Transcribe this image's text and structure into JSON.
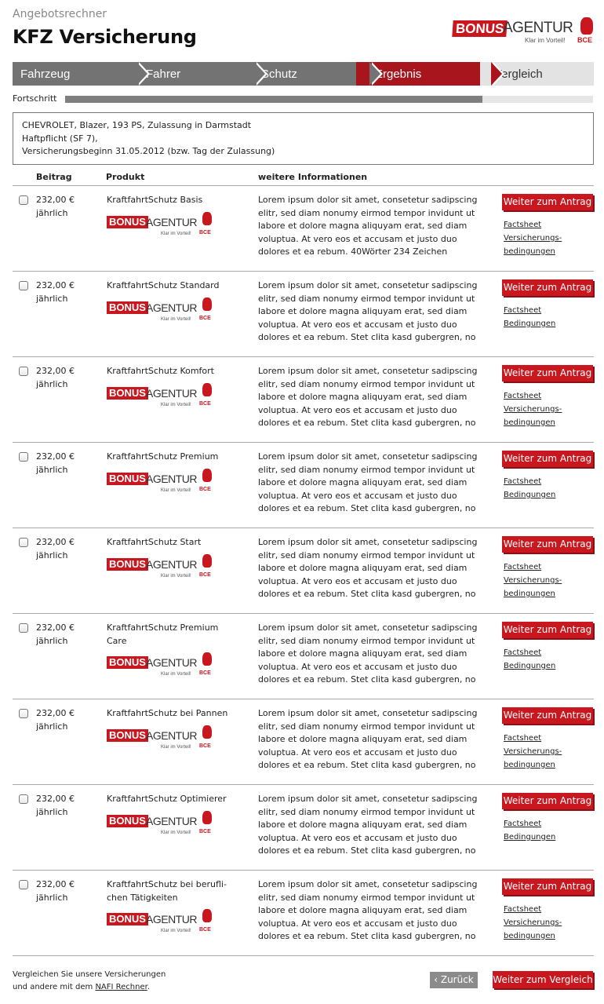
{
  "header": {
    "subtitle": "Angebotsrechner",
    "title": "KFZ Versicherung"
  },
  "logo": {
    "bonus": "BONUS",
    "agentur": "AGENTUR",
    "tagline": "Klar im Vorteil!",
    "bce": "BCE"
  },
  "steps": [
    "Fahrzeug",
    "Fahrer",
    "Schutz",
    "Ergebnis",
    "Vergleich"
  ],
  "progress": {
    "label": "Fortschritt",
    "fraction": 0.79
  },
  "summary": {
    "line1": "CHEVROLET, Blazer, 193 PS, Zulassung in Darmstadt",
    "line2": "Haftpflicht (SF 7),",
    "line3": "Versicherungsbeginn 31.05.2012 (bzw. Tag der Zulassung)"
  },
  "columns": {
    "beitrag": "Beitrag",
    "produkt": "Produkt",
    "info": "weitere Informationen"
  },
  "cta_label": "Weiter zum Antrag",
  "rows": [
    {
      "price": "232,00 €",
      "period": "jährlich",
      "product": "KraftfahrtSchutz Basis",
      "info": "Lorem ipsum dolor sit amet, consetetur sadipscing elitr, sed diam nonumy eirmod tempor invidunt ut labore et dolore magna aliquyam erat, sed diam voluptua. At vero eos et accusam et justo duo dolores et ea rebum. 40Wörter 234 Zeichen",
      "links": [
        "Factsheet",
        "Versicherungs-",
        "bedingungen"
      ]
    },
    {
      "price": "232,00 €",
      "period": "jährlich",
      "product": "KraftfahrtSchutz Standard",
      "info": "Lorem ipsum dolor sit amet, consetetur sadipscing elitr, sed diam nonumy eirmod tempor invidunt ut labore et dolore magna aliquyam erat, sed diam voluptua. At vero eos et accusam et justo duo dolores et ea rebum. Stet clita kasd gubergren, no",
      "links": [
        "Factsheet",
        "Bedingungen"
      ]
    },
    {
      "price": "232,00 €",
      "period": "jährlich",
      "product": "KraftfahrtSchutz Komfort",
      "info": "Lorem ipsum dolor sit amet, consetetur sadipscing elitr, sed diam nonumy eirmod tempor invidunt ut labore et dolore magna aliquyam erat, sed diam voluptua. At vero eos et accusam et justo duo dolores et ea rebum. Stet clita kasd gubergren, no",
      "links": [
        "Factsheet",
        "Versicherungs-",
        "bedingungen"
      ]
    },
    {
      "price": "232,00 €",
      "period": "jährlich",
      "product": "KraftfahrtSchutz Premium",
      "info": "Lorem ipsum dolor sit amet, consetetur sadipscing elitr, sed diam nonumy eirmod tempor invidunt ut labore et dolore magna aliquyam erat, sed diam voluptua. At vero eos et accusam et justo duo dolores et ea rebum. Stet clita kasd gubergren, no",
      "links": [
        "Factsheet",
        "Bedingungen"
      ]
    },
    {
      "price": "232,00 €",
      "period": "jährlich",
      "product": "KraftfahrtSchutz Start",
      "info": "Lorem ipsum dolor sit amet, consetetur sadipscing elitr, sed diam nonumy eirmod tempor invidunt ut labore et dolore magna aliquyam erat, sed diam voluptua. At vero eos et accusam et justo duo dolores et ea rebum. Stet clita kasd gubergren, no",
      "links": [
        "Factsheet",
        "Versicherungs-",
        "bedingungen"
      ]
    },
    {
      "price": "232,00 €",
      "period": "jährlich",
      "product": "KraftfahrtSchutz Premium Care",
      "info": "Lorem ipsum dolor sit amet, consetetur sadipscing elitr, sed diam nonumy eirmod tempor invidunt ut labore et dolore magna aliquyam erat, sed diam voluptua. At vero eos et accusam et justo duo dolores et ea rebum. Stet clita kasd gubergren, no",
      "links": [
        "Factsheet",
        "Bedingungen"
      ]
    },
    {
      "price": "232,00 €",
      "period": "jährlich",
      "product": "KraftfahrtSchutz bei Pannen",
      "info": "Lorem ipsum dolor sit amet, consetetur sadipscing elitr, sed diam nonumy eirmod tempor invidunt ut labore et dolore magna aliquyam erat, sed diam voluptua. At vero eos et accusam et justo duo dolores et ea rebum. Stet clita kasd gubergren, no",
      "links": [
        "Factsheet",
        "Versicherungs-",
        "bedingungen"
      ]
    },
    {
      "price": "232,00 €",
      "period": "jährlich",
      "product": "KraftfahrtSchutz Optimierer",
      "info": "Lorem ipsum dolor sit amet, consetetur sadipscing elitr, sed diam nonumy eirmod tempor invidunt ut labore et dolore magna aliquyam erat, sed diam voluptua. At vero eos et accusam et justo duo dolores et ea rebum. Stet clita kasd gubergren, no",
      "links": [
        "Factsheet",
        "Bedingungen"
      ]
    },
    {
      "price": "232,00 €",
      "period": "jährlich",
      "product": "KraftfahrtSchutz bei berufli-chen Tätigkeiten",
      "info": "Lorem ipsum dolor sit amet, consetetur sadipscing elitr, sed diam nonumy eirmod tempor invidunt ut labore et dolore magna aliquyam erat, sed diam voluptua. At vero eos et accusam et justo duo dolores et ea rebum. Stet clita kasd gubergren, no",
      "links": [
        "Factsheet",
        "Versicherungs-",
        "bedingungen"
      ]
    }
  ],
  "footer": {
    "text_line1": "Vergleichen Sie unsere Versicherungen",
    "text_line2_prefix": "und andere mit dem ",
    "link": "NAFI Rechner",
    "text_line2_suffix": ".",
    "back_label": "‹ Zurück",
    "compare_label": "Weiter zum Vergleich"
  },
  "colors": {
    "accent": "#c8171e",
    "step_active": "#a8151c",
    "step_done": "#737373",
    "step_pending": "#e3e3e3"
  }
}
